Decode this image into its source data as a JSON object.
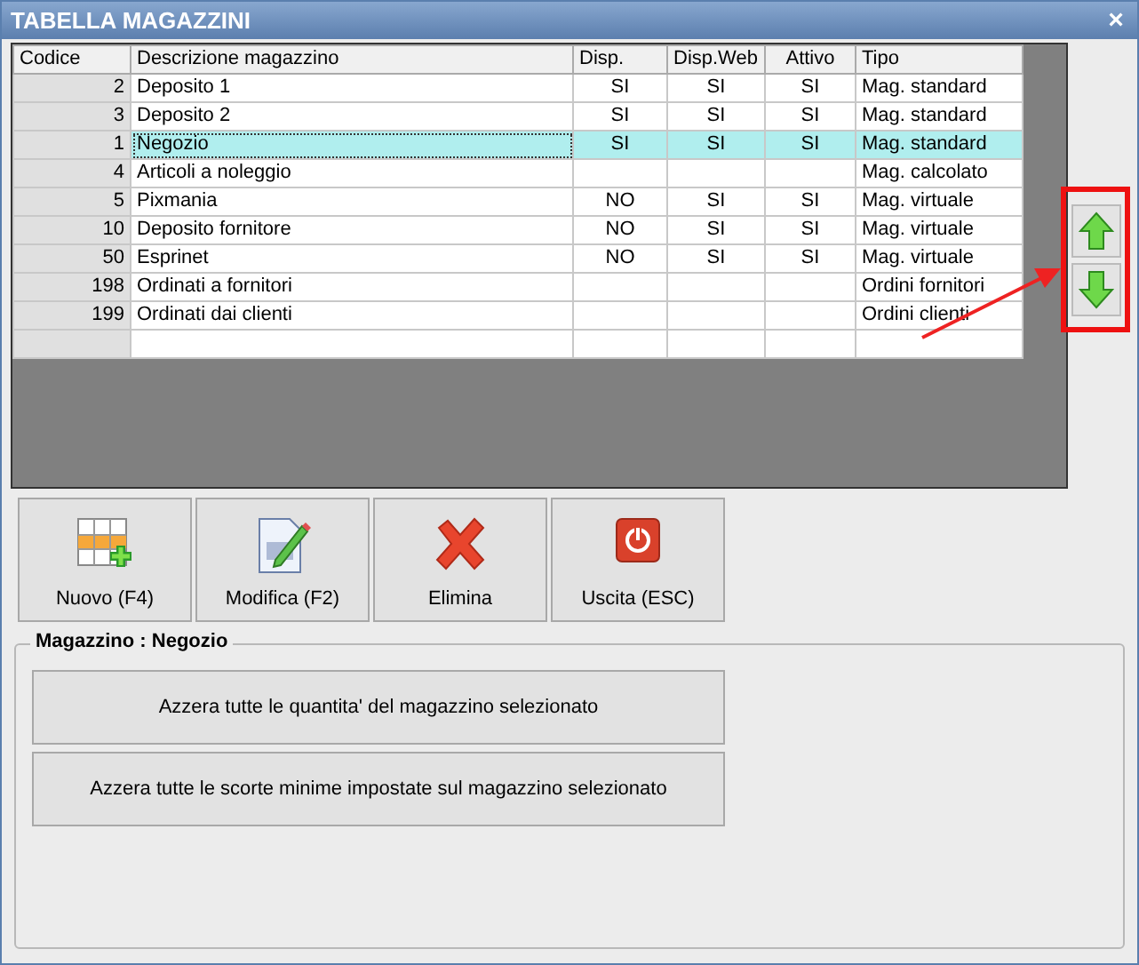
{
  "window": {
    "title": "TABELLA MAGAZZINI",
    "close": "×"
  },
  "table": {
    "columns": [
      "Codice",
      "Descrizione magazzino",
      "Disp.",
      "Disp.Web",
      "Attivo",
      "Tipo"
    ],
    "rows": [
      {
        "codice": "2",
        "descrizione": "Deposito 1",
        "disp": "SI",
        "disp_web": "SI",
        "attivo": "SI",
        "tipo": "Mag. standard",
        "selected": false
      },
      {
        "codice": "3",
        "descrizione": "Deposito 2",
        "disp": "SI",
        "disp_web": "SI",
        "attivo": "SI",
        "tipo": "Mag. standard",
        "selected": false
      },
      {
        "codice": "1",
        "descrizione": "Negozio",
        "disp": "SI",
        "disp_web": "SI",
        "attivo": "SI",
        "tipo": "Mag. standard",
        "selected": true
      },
      {
        "codice": "4",
        "descrizione": "Articoli a noleggio",
        "disp": "",
        "disp_web": "",
        "attivo": "",
        "tipo": "Mag. calcolato",
        "selected": false
      },
      {
        "codice": "5",
        "descrizione": "Pixmania",
        "disp": "NO",
        "disp_web": "SI",
        "attivo": "SI",
        "tipo": "Mag. virtuale",
        "selected": false
      },
      {
        "codice": "10",
        "descrizione": "Deposito fornitore",
        "disp": "NO",
        "disp_web": "SI",
        "attivo": "SI",
        "tipo": "Mag. virtuale",
        "selected": false
      },
      {
        "codice": "50",
        "descrizione": "Esprinet",
        "disp": "NO",
        "disp_web": "SI",
        "attivo": "SI",
        "tipo": "Mag. virtuale",
        "selected": false
      },
      {
        "codice": "198",
        "descrizione": "Ordinati a fornitori",
        "disp": "",
        "disp_web": "",
        "attivo": "",
        "tipo": "Ordini fornitori",
        "selected": false
      },
      {
        "codice": "199",
        "descrizione": "Ordinati dai clienti",
        "disp": "",
        "disp_web": "",
        "attivo": "",
        "tipo": "Ordini clienti",
        "selected": false
      }
    ]
  },
  "toolbar": [
    {
      "kind": "new",
      "label": "Nuovo (F4)"
    },
    {
      "kind": "edit",
      "label": "Modifica (F2)"
    },
    {
      "kind": "delete",
      "label": "Elimina"
    },
    {
      "kind": "exit",
      "label": "Uscita (ESC)"
    }
  ],
  "group": {
    "title": "Magazzino : Negozio",
    "buttons": [
      "Azzera tutte le quantita' del magazzino selezionato",
      "Azzera tutte le scorte minime impostate sul magazzino selezionato"
    ]
  }
}
